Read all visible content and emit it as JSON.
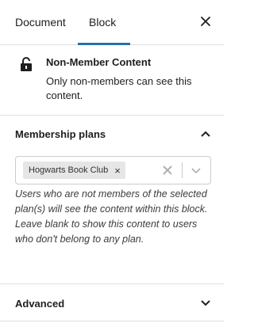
{
  "tabs": [
    {
      "label": "Document"
    },
    {
      "label": "Block"
    }
  ],
  "block_card": {
    "icon": "lock-icon",
    "title": "Non-Member Content",
    "description": "Only non-members can see this content."
  },
  "membership": {
    "title": "Membership plans",
    "selected_tag": "Hogwarts Book Club",
    "help": "Users who are not members of the selected plan(s) will see the content within this block. Leave blank to show this content to users who don't belong to any plan."
  },
  "advanced": {
    "title": "Advanced"
  },
  "colors": {
    "accent": "#2271b1",
    "border": "#e0e0e0",
    "tag_bg": "#e6e6e6"
  }
}
